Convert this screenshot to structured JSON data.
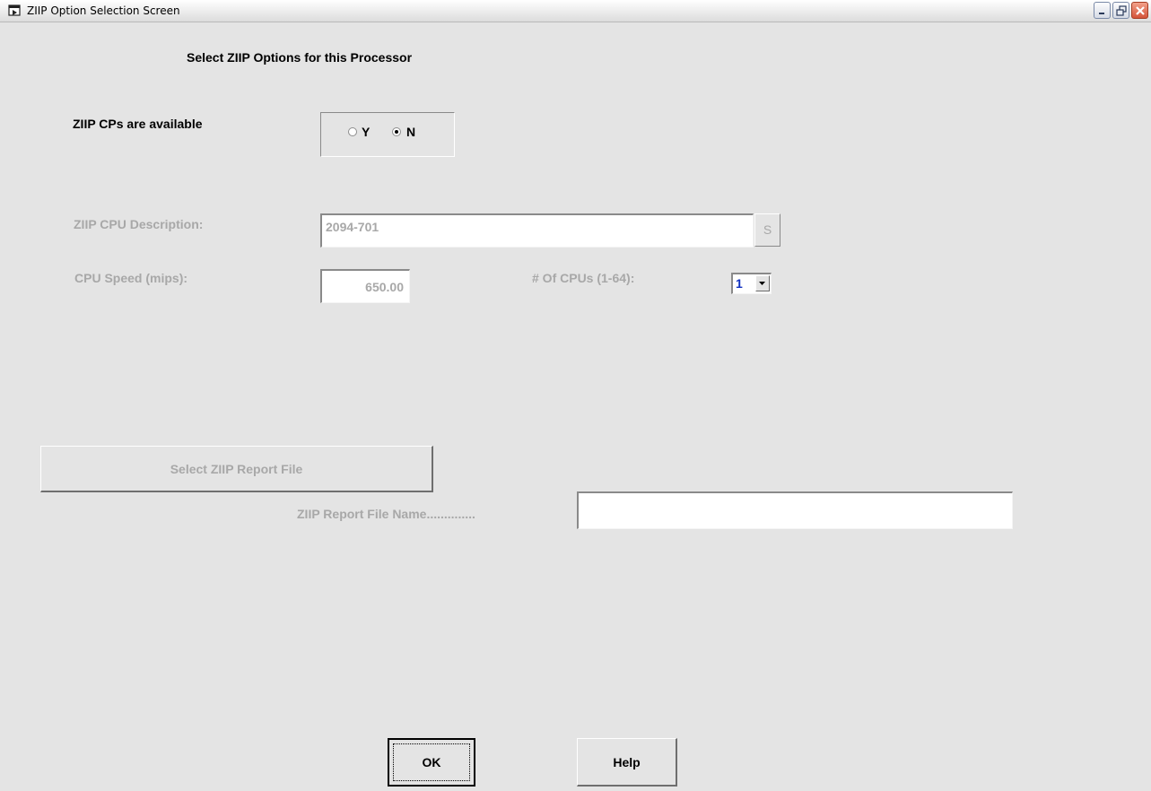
{
  "window": {
    "title": "ZIIP Option Selection Screen",
    "controls": [
      "minimize-icon",
      "restore-icon",
      "close-icon"
    ]
  },
  "heading": "Select ZIIP Options for this Processor",
  "availability": {
    "label": "ZIIP CPs are available",
    "options": [
      {
        "label": "Y",
        "selected": false
      },
      {
        "label": "N",
        "selected": true
      }
    ]
  },
  "cpu_description": {
    "label": "ZIIP CPU Description:",
    "value": "2094-701",
    "button_label": "S"
  },
  "cpu_speed": {
    "label": "CPU Speed (mips):",
    "value": "650.00"
  },
  "cpu_count": {
    "label": "# Of CPUs (1-64):",
    "value": "1"
  },
  "report": {
    "button_label": "Select ZIIP Report File",
    "file_label": "ZIIP Report File Name..............",
    "file_value": ""
  },
  "buttons": {
    "ok": "OK",
    "help": "Help"
  },
  "colors": {
    "background": "#e4e4e4",
    "disabled_text": "#a8a8a8",
    "select_value": "#1030c0"
  }
}
